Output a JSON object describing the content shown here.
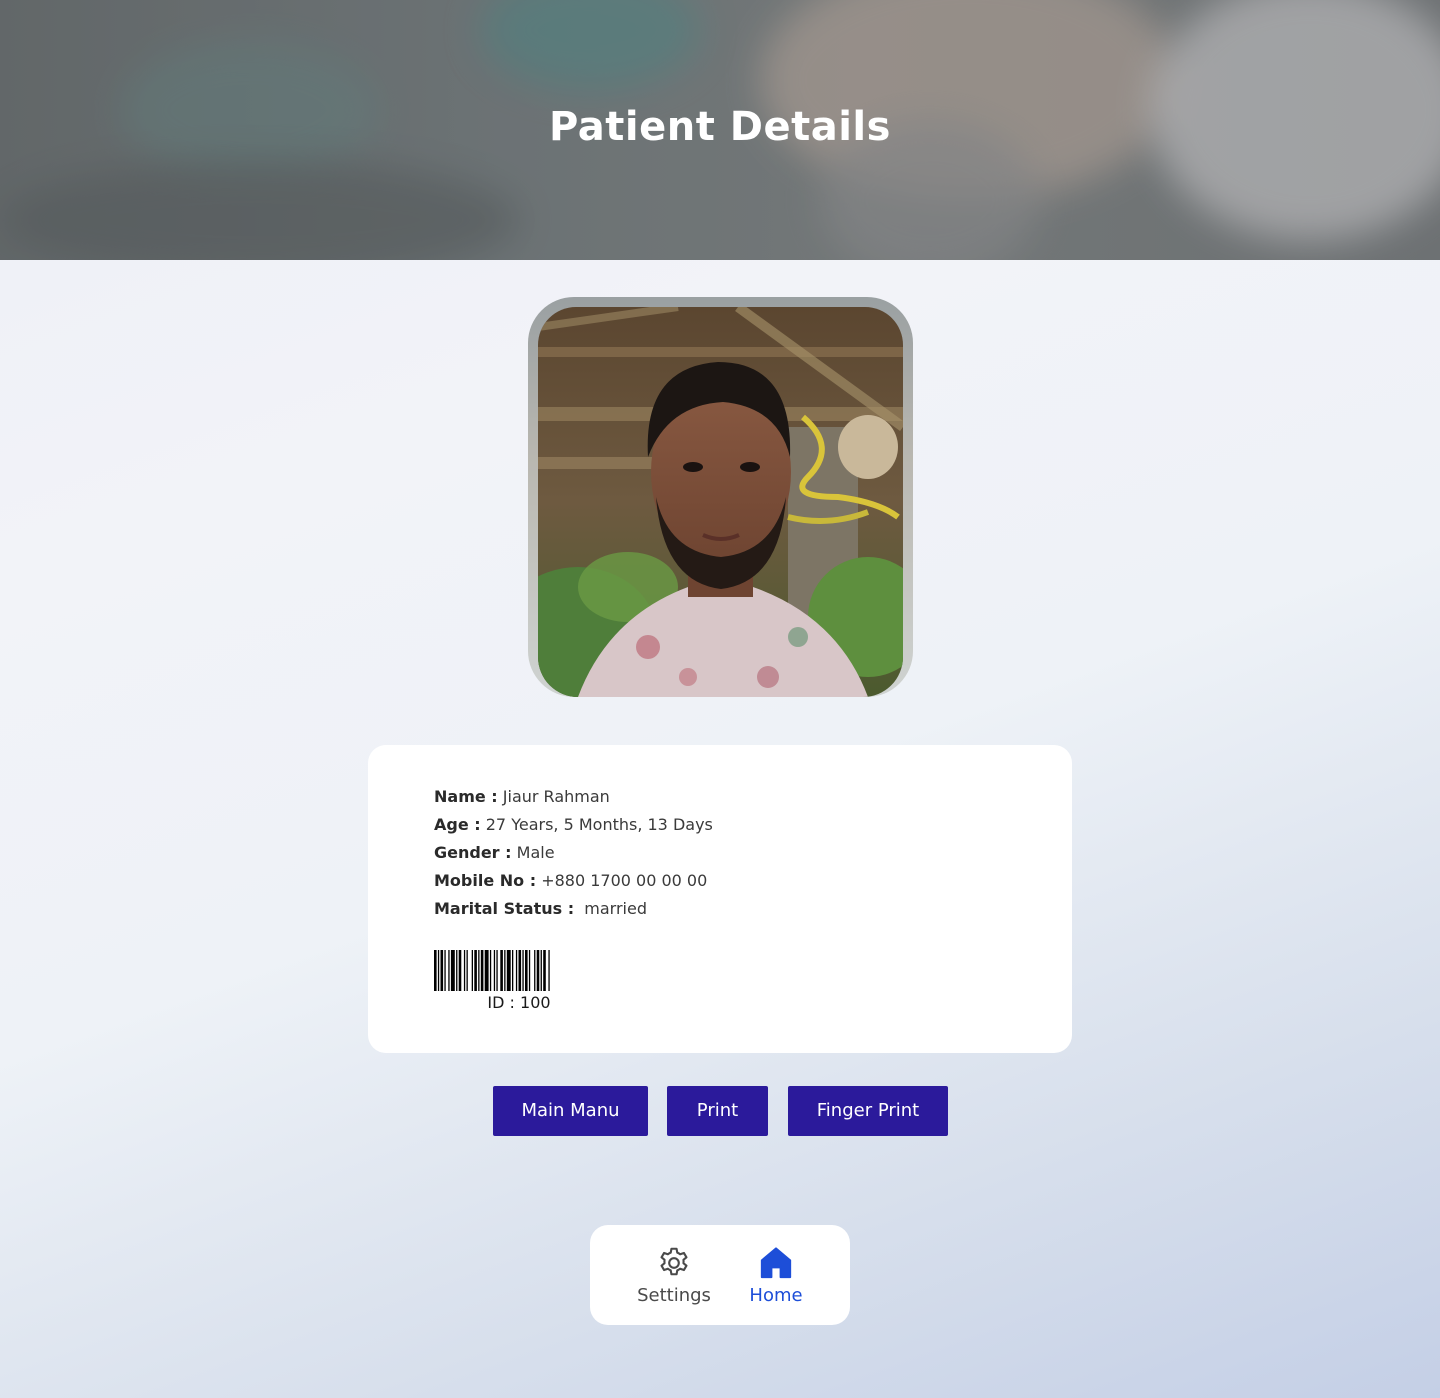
{
  "header": {
    "title": "Patient Details"
  },
  "patient": {
    "photo_alt": "Patient photo",
    "fields": [
      {
        "label": "Name :",
        "value": "Jiaur Rahman"
      },
      {
        "label": "Age :",
        "value": "27 Years, 5 Months, 13 Days"
      },
      {
        "label": "Gender :",
        "value": "Male"
      },
      {
        "label": "Mobile No :",
        "value": "+880 1700 00 00 00"
      },
      {
        "label": "Marital Status :",
        "value": " married"
      }
    ],
    "barcode_id": "ID : 100"
  },
  "actions": {
    "main_menu": "Main Manu",
    "print": "Print",
    "finger_print": "Finger Print"
  },
  "bottom_nav": {
    "items": [
      {
        "label": "Settings",
        "icon": "gear-icon",
        "active": false
      },
      {
        "label": "Home",
        "icon": "home-icon",
        "active": true
      }
    ]
  },
  "colors": {
    "button_bg": "#2b1a9b",
    "nav_active": "#1d4ed8",
    "nav_inactive": "#4a4a4a"
  }
}
